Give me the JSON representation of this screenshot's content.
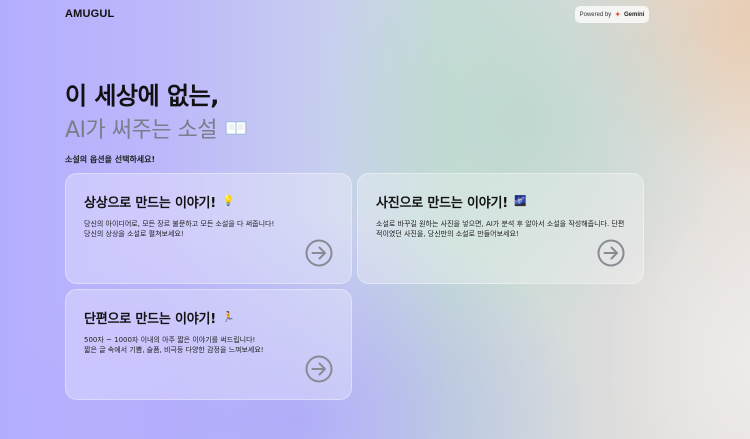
{
  "header": {
    "logo": "AMUGUL",
    "powered_by": "Powered by",
    "provider": "Gemini"
  },
  "hero": {
    "line1": "이 세상에 없는,",
    "line2": "AI가 써주는 소설",
    "icon": "book-icon"
  },
  "section_label": "소설의 옵션을 선택하세요!",
  "cards": [
    {
      "title": "상상으로 만드는 이야기!",
      "emoji": "💡",
      "desc": [
        "당신의 아이디어로, 모든 장르 불문하고 모든 소설을 다 써줍니다!",
        "당신의 상상을 소설로 펼쳐보세요!"
      ],
      "icon": "arrow-right-circle-icon"
    },
    {
      "title": "사진으로 만드는 이야기!",
      "emoji": "🌌",
      "desc": [
        "소설로 바꾸길 원하는 사진을 넣으면, AI가 분석 후 알아서 소설을 작성해줍니다. 단편적이였던 사진을, 당신만의 소설로 만들어보세요!"
      ],
      "icon": "arrow-right-circle-icon"
    },
    {
      "title": "단편으로 만드는 이야기!",
      "emoji": "🏃",
      "desc": [
        "500자 ~ 1000자 이내의 아주 짧은 이야기를 써드립니다!",
        "짧은 글 속에서 기쁨, 슬픔, 비극등 다양한 감정을 느껴보세요!"
      ],
      "icon": "arrow-right-circle-icon"
    }
  ],
  "colors": {
    "text_dark": "#111111",
    "text_muted": "#7c7c8a",
    "arrow": "#8a8a94",
    "gemini_accent": "#e0563b"
  }
}
